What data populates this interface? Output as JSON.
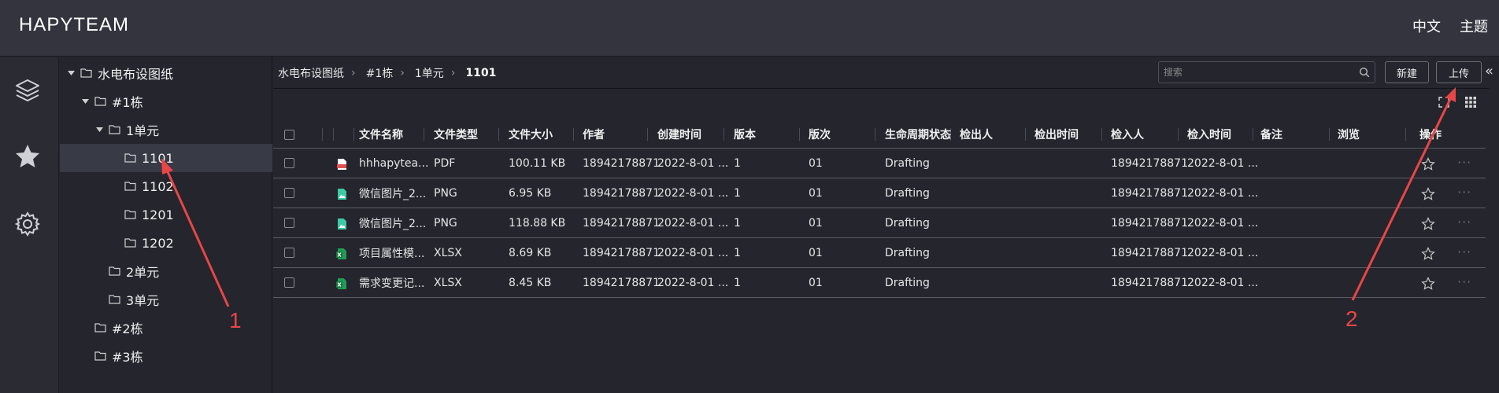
{
  "header": {
    "brand": "HAPYTEAM",
    "lang": "中文",
    "theme": "主题"
  },
  "leftrail": {
    "icons": [
      "layers-icon",
      "star-icon",
      "gear-icon"
    ]
  },
  "tree": {
    "items": [
      {
        "label": "水电布设图纸",
        "level": 0,
        "expanded": true
      },
      {
        "label": "#1栋",
        "level": 1,
        "expanded": true
      },
      {
        "label": "1单元",
        "level": 2,
        "expanded": true
      },
      {
        "label": "1101",
        "level": 3,
        "selected": true
      },
      {
        "label": "1102",
        "level": 3
      },
      {
        "label": "1201",
        "level": 3
      },
      {
        "label": "1202",
        "level": 3
      },
      {
        "label": "2单元",
        "level": 2
      },
      {
        "label": "3单元",
        "level": 2
      },
      {
        "label": "#2栋",
        "level": 1
      },
      {
        "label": "#3栋",
        "level": 1
      }
    ]
  },
  "breadcrumb": [
    "水电布设图纸",
    "#1栋",
    "1单元",
    "1101"
  ],
  "search": {
    "placeholder": "搜索",
    "value": ""
  },
  "buttons": {
    "new": "新建",
    "upload": "上传"
  },
  "collapse_glyph": "«",
  "table": {
    "columns": [
      "文件名称",
      "文件类型",
      "文件大小",
      "作者",
      "创建时间",
      "版本",
      "版次",
      "生命周期状态",
      "检出人",
      "检出时间",
      "检入人",
      "检入时间",
      "备注",
      "浏览",
      "操作"
    ],
    "rows": [
      {
        "icon": "pdf-file-icon",
        "name": "hhhapytea...",
        "type": "PDF",
        "size": "100.11 KB",
        "author": "18942178871",
        "created": "2022-8-01 ...",
        "version": "1",
        "edition": "01",
        "status": "Drafting",
        "checkout_by": "",
        "checkout_time": "",
        "checkin_by": "18942178871",
        "checkin_time": "2022-8-01 ..."
      },
      {
        "icon": "image-file-icon",
        "name": "微信图片_2...",
        "type": "PNG",
        "size": "6.95 KB",
        "author": "18942178871",
        "created": "2022-8-01 ...",
        "version": "1",
        "edition": "01",
        "status": "Drafting",
        "checkout_by": "",
        "checkout_time": "",
        "checkin_by": "18942178871",
        "checkin_time": "2022-8-01 ..."
      },
      {
        "icon": "image-file-icon",
        "name": "微信图片_2...",
        "type": "PNG",
        "size": "118.88 KB",
        "author": "18942178871",
        "created": "2022-8-01 ...",
        "version": "1",
        "edition": "01",
        "status": "Drafting",
        "checkout_by": "",
        "checkout_time": "",
        "checkin_by": "18942178871",
        "checkin_time": "2022-8-01 ..."
      },
      {
        "icon": "excel-file-icon",
        "name": "项目属性模...",
        "type": "XLSX",
        "size": "8.69 KB",
        "author": "18942178871",
        "created": "2022-8-01 ...",
        "version": "1",
        "edition": "01",
        "status": "Drafting",
        "checkout_by": "",
        "checkout_time": "",
        "checkin_by": "18942178871",
        "checkin_time": "2022-8-01 ..."
      },
      {
        "icon": "excel-file-icon",
        "name": "需求变更记...",
        "type": "XLSX",
        "size": "8.45 KB",
        "author": "18942178871",
        "created": "2022-8-01 ...",
        "version": "1",
        "edition": "01",
        "status": "Drafting",
        "checkout_by": "",
        "checkout_time": "",
        "checkin_by": "18942178871",
        "checkin_time": "2022-8-01 ..."
      }
    ],
    "more_glyph": "···"
  },
  "annotations": [
    "1",
    "2"
  ],
  "colors": {
    "background": "#24252d",
    "topbar": "#33343e",
    "selected_row": "#383a45",
    "annotation": "#e84646",
    "pdf": "#e05252",
    "image": "#3ec9a7",
    "excel": "#1f9d55"
  }
}
